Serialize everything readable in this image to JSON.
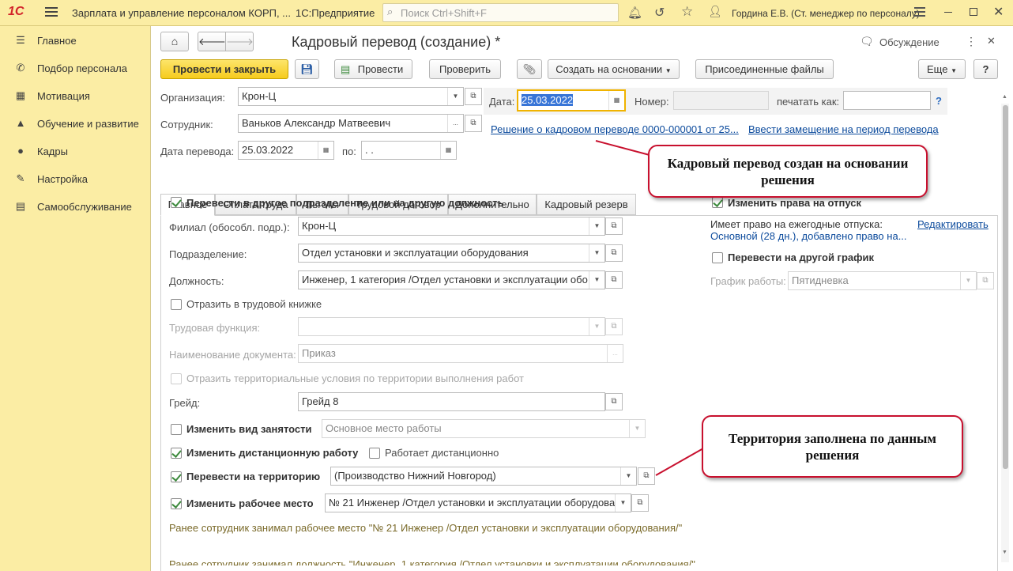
{
  "app": {
    "logo": "1С",
    "title": "Зарплата и управление персоналом КОРП, ...",
    "platform": "1С:Предприятие",
    "search_placeholder": "Поиск Ctrl+Shift+F",
    "user": "Гордина Е.В. (Ст. менеджер по персоналу)"
  },
  "sidebar": {
    "items": [
      {
        "label": "Главное",
        "icon": "menu-lines-icon"
      },
      {
        "label": "Подбор персонала",
        "icon": "phone-icon"
      },
      {
        "label": "Мотивация",
        "icon": "gift-icon"
      },
      {
        "label": "Обучение и развитие",
        "icon": "graduation-cap-icon"
      },
      {
        "label": "Кадры",
        "icon": "people-icon"
      },
      {
        "label": "Настройка",
        "icon": "wrench-icon"
      },
      {
        "label": "Самообслуживание",
        "icon": "card-icon"
      }
    ]
  },
  "form": {
    "title": "Кадровый перевод (создание) *",
    "discussion": "Обсуждение",
    "toolbar": {
      "post_close": "Провести и закрыть",
      "post": "Провести",
      "check": "Проверить",
      "create_based": "Создать на основании",
      "attached_files": "Присоединенные файлы",
      "more": "Еще",
      "help": "?"
    },
    "header": {
      "org_label": "Организация:",
      "org_value": "Крон-Ц",
      "employee_label": "Сотрудник:",
      "employee_value": "Ваньков Александр Матвеевич",
      "transfer_date_label": "Дата перевода:",
      "transfer_date_value": "25.03.2022",
      "to_label": "по:",
      "to_value": " .  .",
      "date_label": "Дата:",
      "date_value": "25.03.2022",
      "number_label": "Номер:",
      "number_value": "",
      "print_as_label": "печатать как:",
      "print_as_value": "",
      "print_help": "?",
      "decision_link": "Решение о кадровом переводе 0000-000001 от 25...",
      "substitution_link": "Ввести замещение на период перевода"
    },
    "tabs": [
      "Главное",
      "Оплата труда",
      "Льготы",
      "Трудовой договор",
      "Дополнительно",
      "Кадровый резерв"
    ],
    "main": {
      "transfer_cb": "Перевести в другое подразделение или на другую должность",
      "branch_label": "Филиал (обособл. подр.):",
      "branch_value": "Крон-Ц",
      "dept_label": "Подразделение:",
      "dept_value": "Отдел установки и эксплуатации оборудования",
      "position_label": "Должность:",
      "position_value": "Инженер, 1 категория /Отдел установки и эксплуатации обо",
      "workbook_cb": "Отразить в трудовой книжке",
      "labor_func_label": "Трудовая функция:",
      "labor_func_value": "",
      "doc_name_label": "Наименование документа:",
      "doc_name_value": "Приказ",
      "territorial_cb": "Отразить территориальные условия по территории выполнения работ",
      "grade_label": "Грейд:",
      "grade_value": "Грейд 8",
      "employment_cb": "Изменить вид занятости",
      "employment_value": "Основное место работы",
      "remote_cb": "Изменить дистанционную работу",
      "works_remote_cb": "Работает дистанционно",
      "territory_cb": "Перевести на территорию",
      "territory_value": "(Производство Нижний Новгород)",
      "workplace_cb": "Изменить рабочее место",
      "workplace_value": "№ 21 Инженер /Отдел установки и эксплуатации оборудова",
      "prev_workplace": "Ранее сотрудник занимал рабочее место \"№ 21 Инженер /Отдел установки и эксплуатации оборудования/\"",
      "prev_position": "Ранее сотрудник занимал должность \"Инженер, 1 категория /Отдел установки и эксплуатации оборудования/\""
    },
    "right": {
      "vacation_cb": "Изменить права на отпуск",
      "vacation_text": "Имеет право на ежегодные отпуска:",
      "edit_link": "Редактировать",
      "vacation_detail": "Основной (28 дн.), добавлено право на...",
      "schedule_cb": "Перевести на другой график",
      "schedule_label": "График работы:",
      "schedule_value": "Пятидневка"
    }
  },
  "callouts": {
    "decision": "Кадровый перевод создан на основании решения",
    "territory": "Территория заполнена по данным решения"
  },
  "colors": {
    "accent": "#fbeda4",
    "primary_button": "#f6cb1d",
    "callout_border": "#c8102e",
    "link": "#0b4a9c"
  }
}
